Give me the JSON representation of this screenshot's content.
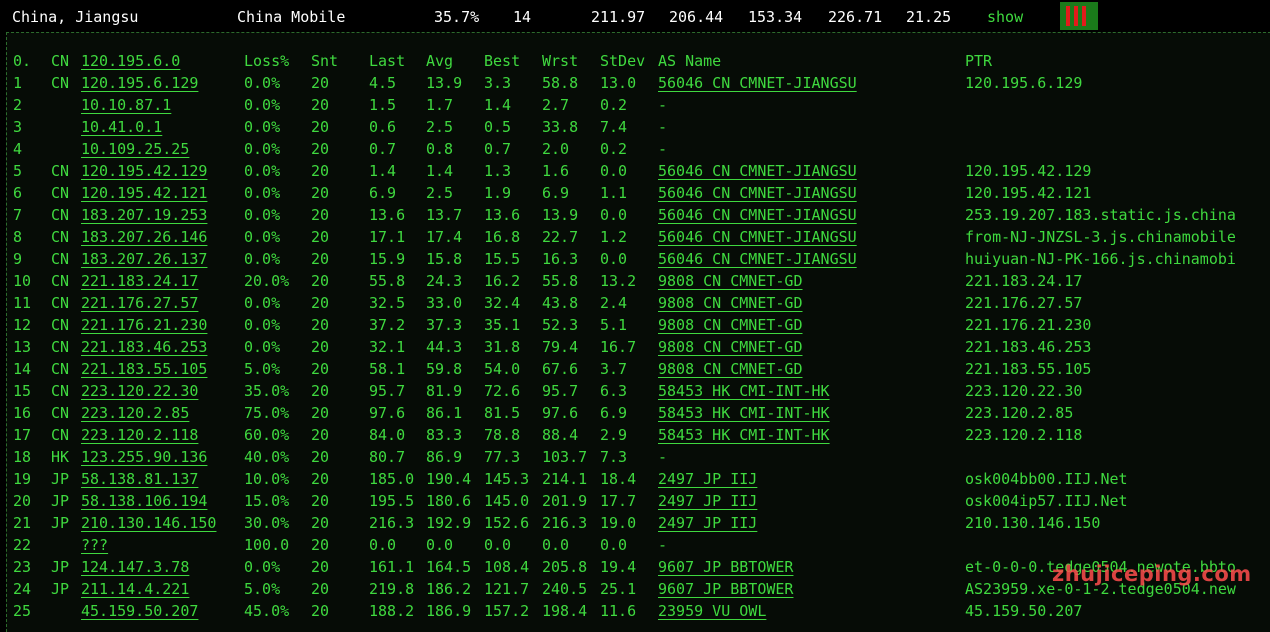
{
  "summary": {
    "location": "China, Jiangsu",
    "isp": "China Mobile",
    "loss": "35.7%",
    "snt": "14",
    "last": "211.97",
    "avg": "206.44",
    "best": "153.34",
    "wrst": "226.71",
    "stdev": "21.25",
    "show_label": "show"
  },
  "columns": {
    "idx": "0.",
    "cc": "CN",
    "host": "120.195.6.0",
    "loss": "Loss%",
    "snt": "Snt",
    "last": "Last",
    "avg": "Avg",
    "best": "Best",
    "wrst": "Wrst",
    "stdev": "StDev",
    "as": "AS Name",
    "ptr": "PTR"
  },
  "hops": [
    {
      "idx": "1",
      "cc": "CN",
      "host": "120.195.6.129",
      "loss": "0.0%",
      "snt": "20",
      "last": "4.5",
      "avg": "13.9",
      "best": "3.3",
      "wrst": "58.8",
      "stdev": "13.0",
      "as": "56046 CN CMNET-JIANGSU",
      "ptr": "120.195.6.129"
    },
    {
      "idx": "2",
      "cc": "",
      "host": "10.10.87.1",
      "loss": "0.0%",
      "snt": "20",
      "last": "1.5",
      "avg": "1.7",
      "best": "1.4",
      "wrst": "2.7",
      "stdev": "0.2",
      "as": "-",
      "ptr": ""
    },
    {
      "idx": "3",
      "cc": "",
      "host": "10.41.0.1",
      "loss": "0.0%",
      "snt": "20",
      "last": "0.6",
      "avg": "2.5",
      "best": "0.5",
      "wrst": "33.8",
      "stdev": "7.4",
      "as": "-",
      "ptr": ""
    },
    {
      "idx": "4",
      "cc": "",
      "host": "10.109.25.25",
      "loss": "0.0%",
      "snt": "20",
      "last": "0.7",
      "avg": "0.8",
      "best": "0.7",
      "wrst": "2.0",
      "stdev": "0.2",
      "as": "-",
      "ptr": ""
    },
    {
      "idx": "5",
      "cc": "CN",
      "host": "120.195.42.129",
      "loss": "0.0%",
      "snt": "20",
      "last": "1.4",
      "avg": "1.4",
      "best": "1.3",
      "wrst": "1.6",
      "stdev": "0.0",
      "as": "56046 CN CMNET-JIANGSU",
      "ptr": "120.195.42.129"
    },
    {
      "idx": "6",
      "cc": "CN",
      "host": "120.195.42.121",
      "loss": "0.0%",
      "snt": "20",
      "last": "6.9",
      "avg": "2.5",
      "best": "1.9",
      "wrst": "6.9",
      "stdev": "1.1",
      "as": "56046 CN CMNET-JIANGSU",
      "ptr": "120.195.42.121"
    },
    {
      "idx": "7",
      "cc": "CN",
      "host": "183.207.19.253",
      "loss": "0.0%",
      "snt": "20",
      "last": "13.6",
      "avg": "13.7",
      "best": "13.6",
      "wrst": "13.9",
      "stdev": "0.0",
      "as": "56046 CN CMNET-JIANGSU",
      "ptr": "253.19.207.183.static.js.china"
    },
    {
      "idx": "8",
      "cc": "CN",
      "host": "183.207.26.146",
      "loss": "0.0%",
      "snt": "20",
      "last": "17.1",
      "avg": "17.4",
      "best": "16.8",
      "wrst": "22.7",
      "stdev": "1.2",
      "as": "56046 CN CMNET-JIANGSU",
      "ptr": "from-NJ-JNZSL-3.js.chinamobile"
    },
    {
      "idx": "9",
      "cc": "CN",
      "host": "183.207.26.137",
      "loss": "0.0%",
      "snt": "20",
      "last": "15.9",
      "avg": "15.8",
      "best": "15.5",
      "wrst": "16.3",
      "stdev": "0.0",
      "as": "56046 CN CMNET-JIANGSU",
      "ptr": "huiyuan-NJ-PK-166.js.chinamobi"
    },
    {
      "idx": "10",
      "cc": "CN",
      "host": "221.183.24.17",
      "loss": "20.0%",
      "snt": "20",
      "last": "55.8",
      "avg": "24.3",
      "best": "16.2",
      "wrst": "55.8",
      "stdev": "13.2",
      "as": "9808  CN CMNET-GD",
      "ptr": "221.183.24.17"
    },
    {
      "idx": "11",
      "cc": "CN",
      "host": "221.176.27.57",
      "loss": "0.0%",
      "snt": "20",
      "last": "32.5",
      "avg": "33.0",
      "best": "32.4",
      "wrst": "43.8",
      "stdev": "2.4",
      "as": "9808  CN CMNET-GD",
      "ptr": "221.176.27.57"
    },
    {
      "idx": "12",
      "cc": "CN",
      "host": "221.176.21.230",
      "loss": "0.0%",
      "snt": "20",
      "last": "37.2",
      "avg": "37.3",
      "best": "35.1",
      "wrst": "52.3",
      "stdev": "5.1",
      "as": "9808  CN CMNET-GD",
      "ptr": "221.176.21.230"
    },
    {
      "idx": "13",
      "cc": "CN",
      "host": "221.183.46.253",
      "loss": "0.0%",
      "snt": "20",
      "last": "32.1",
      "avg": "44.3",
      "best": "31.8",
      "wrst": "79.4",
      "stdev": "16.7",
      "as": "9808  CN CMNET-GD",
      "ptr": "221.183.46.253"
    },
    {
      "idx": "14",
      "cc": "CN",
      "host": "221.183.55.105",
      "loss": "5.0%",
      "snt": "20",
      "last": "58.1",
      "avg": "59.8",
      "best": "54.0",
      "wrst": "67.6",
      "stdev": "3.7",
      "as": "9808  CN CMNET-GD",
      "ptr": "221.183.55.105"
    },
    {
      "idx": "15",
      "cc": "CN",
      "host": "223.120.22.30",
      "loss": "35.0%",
      "snt": "20",
      "last": "95.7",
      "avg": "81.9",
      "best": "72.6",
      "wrst": "95.7",
      "stdev": "6.3",
      "as": "58453 HK CMI-INT-HK",
      "ptr": "223.120.22.30"
    },
    {
      "idx": "16",
      "cc": "CN",
      "host": "223.120.2.85",
      "loss": "75.0%",
      "snt": "20",
      "last": "97.6",
      "avg": "86.1",
      "best": "81.5",
      "wrst": "97.6",
      "stdev": "6.9",
      "as": "58453 HK CMI-INT-HK",
      "ptr": "223.120.2.85"
    },
    {
      "idx": "17",
      "cc": "CN",
      "host": "223.120.2.118",
      "loss": "60.0%",
      "snt": "20",
      "last": "84.0",
      "avg": "83.3",
      "best": "78.8",
      "wrst": "88.4",
      "stdev": "2.9",
      "as": "58453 HK CMI-INT-HK",
      "ptr": "223.120.2.118"
    },
    {
      "idx": "18",
      "cc": "HK",
      "host": "123.255.90.136",
      "loss": "40.0%",
      "snt": "20",
      "last": "80.7",
      "avg": "86.9",
      "best": "77.3",
      "wrst": "103.7",
      "stdev": "7.3",
      "as": "-",
      "ptr": ""
    },
    {
      "idx": "19",
      "cc": "JP",
      "host": "58.138.81.137",
      "loss": "10.0%",
      "snt": "20",
      "last": "185.0",
      "avg": "190.4",
      "best": "145.3",
      "wrst": "214.1",
      "stdev": "18.4",
      "as": "2497  JP IIJ",
      "ptr": "osk004bb00.IIJ.Net"
    },
    {
      "idx": "20",
      "cc": "JP",
      "host": "58.138.106.194",
      "loss": "15.0%",
      "snt": "20",
      "last": "195.5",
      "avg": "180.6",
      "best": "145.0",
      "wrst": "201.9",
      "stdev": "17.7",
      "as": "2497  JP IIJ",
      "ptr": "osk004ip57.IIJ.Net"
    },
    {
      "idx": "21",
      "cc": "JP",
      "host": "210.130.146.150",
      "loss": "30.0%",
      "snt": "20",
      "last": "216.3",
      "avg": "192.9",
      "best": "152.6",
      "wrst": "216.3",
      "stdev": "19.0",
      "as": "2497  JP IIJ",
      "ptr": "210.130.146.150"
    },
    {
      "idx": "22",
      "cc": "",
      "host": "???",
      "loss": "100.0",
      "snt": "20",
      "last": "0.0",
      "avg": "0.0",
      "best": "0.0",
      "wrst": "0.0",
      "stdev": "0.0",
      "as": "-",
      "ptr": ""
    },
    {
      "idx": "23",
      "cc": "JP",
      "host": "124.147.3.78",
      "loss": "0.0%",
      "snt": "20",
      "last": "161.1",
      "avg": "164.5",
      "best": "108.4",
      "wrst": "205.8",
      "stdev": "19.4",
      "as": "9607  JP BBTOWER",
      "ptr": "et-0-0-0.tedge0504.newote.bbto"
    },
    {
      "idx": "24",
      "cc": "JP",
      "host": "211.14.4.221",
      "loss": "5.0%",
      "snt": "20",
      "last": "219.8",
      "avg": "186.2",
      "best": "121.7",
      "wrst": "240.5",
      "stdev": "25.1",
      "as": "9607  JP BBTOWER",
      "ptr": "AS23959.xe-0-1-2.tedge0504.new"
    },
    {
      "idx": "25",
      "cc": "",
      "host": "45.159.50.207",
      "loss": "45.0%",
      "snt": "20",
      "last": "188.2",
      "avg": "186.9",
      "best": "157.2",
      "wrst": "198.4",
      "stdev": "11.6",
      "as": "23959 VU OWL",
      "ptr": "45.159.50.207"
    }
  ],
  "watermark": "zhujiceping.com"
}
